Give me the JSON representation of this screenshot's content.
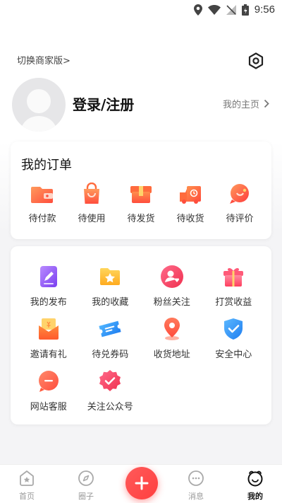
{
  "status_bar": {
    "time": "9:56"
  },
  "profile": {
    "switch_link": "切换商家版>",
    "login_title": "登录/注册",
    "homepage_link": "我的主页"
  },
  "orders": {
    "title": "我的订单",
    "items": [
      {
        "label": "待付款",
        "icon": "wallet-icon"
      },
      {
        "label": "待使用",
        "icon": "shopping-bag-icon"
      },
      {
        "label": "待发货",
        "icon": "box-icon"
      },
      {
        "label": "待收货",
        "icon": "truck-icon"
      },
      {
        "label": "待评价",
        "icon": "comment-icon"
      }
    ]
  },
  "services": {
    "items": [
      {
        "label": "我的发布",
        "icon": "edit-document-icon"
      },
      {
        "label": "我的收藏",
        "icon": "star-folder-icon"
      },
      {
        "label": "粉丝关注",
        "icon": "fans-heart-icon"
      },
      {
        "label": "打赏收益",
        "icon": "gift-icon"
      },
      {
        "label": "邀请有礼",
        "icon": "red-envelope-icon"
      },
      {
        "label": "待兑券码",
        "icon": "ticket-icon"
      },
      {
        "label": "收货地址",
        "icon": "location-pin-icon"
      },
      {
        "label": "安全中心",
        "icon": "shield-check-icon"
      },
      {
        "label": "网站客服",
        "icon": "chat-bubble-icon"
      },
      {
        "label": "关注公众号",
        "icon": "verified-badge-icon"
      }
    ]
  },
  "tab_bar": {
    "tabs": [
      {
        "label": "首页",
        "icon": "home-icon"
      },
      {
        "label": "圈子",
        "icon": "compass-icon"
      },
      {
        "label": "消息",
        "icon": "message-icon"
      },
      {
        "label": "我的",
        "icon": "profile-icon",
        "active": true
      }
    ],
    "fab_icon": "plus-icon"
  },
  "colors": {
    "accent_red": "#ff4a4a",
    "accent_orange": "#ff7a3d",
    "accent_blue": "#2f8cf0",
    "accent_purple": "#8b5cf6"
  }
}
